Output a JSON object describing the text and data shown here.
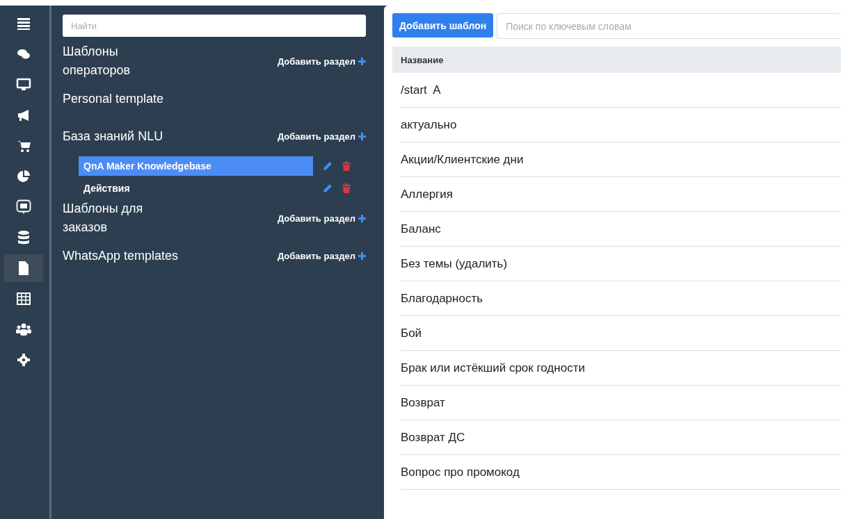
{
  "rail": [
    {
      "kind": "menu",
      "selected": false
    },
    {
      "kind": "chat",
      "selected": false
    },
    {
      "kind": "monitor",
      "selected": false
    },
    {
      "kind": "megaphone",
      "selected": false
    },
    {
      "kind": "cart",
      "selected": false
    },
    {
      "kind": "pie",
      "selected": false
    },
    {
      "kind": "bot",
      "selected": false
    },
    {
      "kind": "database",
      "selected": false
    },
    {
      "kind": "document",
      "selected": true
    },
    {
      "kind": "table",
      "selected": false
    },
    {
      "kind": "users",
      "selected": false
    },
    {
      "kind": "gear",
      "selected": false
    }
  ],
  "sidebar": {
    "search": {
      "placeholder": "Найти"
    },
    "sections": [
      {
        "title": "Шаблоны операторов",
        "add_label": "Добавить раздел"
      },
      {
        "title": "Personal template"
      },
      {
        "title": "База знаний NLU",
        "add_label": "Добавить раздел",
        "children": [
          {
            "label": "QnA Maker Knowledgebase",
            "selected": true
          },
          {
            "label": "Действия",
            "selected": false
          }
        ]
      },
      {
        "title": "Шаблоны для заказов",
        "add_label": "Добавить раздел"
      },
      {
        "title": "WhatsApp templates",
        "add_label": "Добавить раздел"
      }
    ]
  },
  "toolbar": {
    "add_button": "Добавить шаблон",
    "search": {
      "placeholder": "Поиск по ключевым словам"
    }
  },
  "table": {
    "columns": [
      "Название"
    ],
    "rows": [
      "/start  A",
      "актуально",
      "Акции/Клиентские дни",
      "Аллергия",
      "Баланс",
      "Без темы (удалить)",
      "Благодарность",
      "Бой",
      "Брак или истёкший срок годности",
      "Возврат",
      "Возврат ДС",
      "Вопрос про промокод"
    ]
  }
}
